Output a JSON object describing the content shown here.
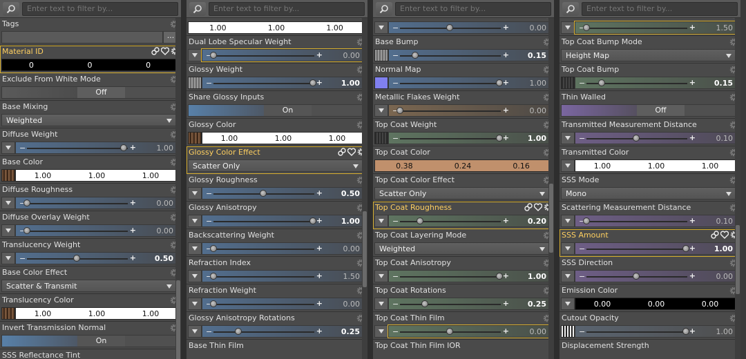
{
  "search_placeholder": "Enter text to filter by...",
  "panels": [
    {
      "props": [
        {
          "label": "Tags",
          "type": "tags",
          "btn": "..."
        },
        {
          "label": "Material ID",
          "type": "color",
          "thumb": null,
          "values": [
            "0",
            "0",
            "0"
          ],
          "bg": "#000",
          "hl": true
        },
        {
          "label": "Exclude From White Mode",
          "type": "toggle",
          "value": "Off"
        },
        {
          "label": "Base Mixing",
          "type": "dropdown",
          "value": "Weighted"
        },
        {
          "label": "Diffuse Weight",
          "type": "slider",
          "knob": 0.97,
          "value": "1.00",
          "bold": false,
          "arrow": true,
          "tint": "blue"
        },
        {
          "label": "Base Color",
          "type": "color",
          "thumb": "hair",
          "values": [
            "1.00",
            "1.00",
            "1.00"
          ],
          "bg": "#fff"
        },
        {
          "label": "Diffuse Roughness",
          "type": "slider",
          "knob": 0.0,
          "value": "0.00",
          "arrow": true,
          "tint": "blue"
        },
        {
          "label": "Diffuse Overlay Weight",
          "type": "slider",
          "knob": 0.0,
          "value": "0.00",
          "arrow": true,
          "tint": "blue"
        },
        {
          "label": "Translucency Weight",
          "type": "slider",
          "knob": 0.5,
          "value": "0.50",
          "bold": true,
          "arrow": true,
          "tint": "blue"
        },
        {
          "label": "Base Color Effect",
          "type": "dropdown",
          "value": "Scatter & Transmit"
        },
        {
          "label": "Translucency Color",
          "type": "color",
          "thumb": "hair",
          "values": [
            "1.00",
            "1.00",
            "1.00"
          ],
          "bg": "#fff"
        },
        {
          "label": "Invert Transmission Normal",
          "type": "toggle",
          "value": "On",
          "on": true
        },
        {
          "label": "SSS Reflectance Tint",
          "type": "partial"
        }
      ]
    },
    {
      "props": [
        {
          "label": "SSS Reflectance Tint",
          "type": "color",
          "thumb": null,
          "values": [
            "1.00",
            "1.00",
            "1.00"
          ],
          "bg": "#fff",
          "top": true
        },
        {
          "label": "Dual Lobe Specular Weight",
          "type": "slider",
          "knob": 0.0,
          "value": "0.00",
          "arrow": true,
          "tint": "blue",
          "hlbox": true
        },
        {
          "label": "Glossy Weight",
          "type": "slider",
          "knob": 1.0,
          "value": "1.00",
          "bold": true,
          "thumb": "grey",
          "tint": "blue"
        },
        {
          "label": "Share Glossy Inputs",
          "type": "toggle",
          "value": "On",
          "on": true
        },
        {
          "label": "Glossy Color",
          "type": "color",
          "thumb": "hair",
          "values": [
            "1.00",
            "1.00",
            "1.00"
          ],
          "bg": "#fff"
        },
        {
          "label": "Glossy Color Effect",
          "type": "dropdown",
          "value": "Scatter Only",
          "hl": true
        },
        {
          "label": "Glossy Roughness",
          "type": "slider",
          "knob": 0.5,
          "value": "0.50",
          "bold": true,
          "arrow": true,
          "tint": "blue"
        },
        {
          "label": "Glossy Anisotropy",
          "type": "slider",
          "knob": 1.0,
          "value": "1.00",
          "bold": true,
          "arrow": true,
          "tint": "blue"
        },
        {
          "label": "Backscattering Weight",
          "type": "slider",
          "knob": 0.0,
          "value": "0.00",
          "arrow": true,
          "tint": "blue"
        },
        {
          "label": "Refraction Index",
          "type": "slider",
          "knob": 0.0,
          "value": "1.50",
          "arrow": true,
          "tint": "blue"
        },
        {
          "label": "Refraction Weight",
          "type": "slider",
          "knob": 0.0,
          "value": "0.00",
          "arrow": true,
          "tint": "blue"
        },
        {
          "label": "Glossy Anisotropy Rotations",
          "type": "slider",
          "knob": 0.25,
          "value": "0.25",
          "bold": true,
          "arrow": true,
          "tint": "blue"
        },
        {
          "label": "Base Thin Film",
          "type": "partial"
        }
      ]
    },
    {
      "props": [
        {
          "label": "Base Thin Film",
          "type": "slider",
          "knob": 0.5,
          "value": "0.00",
          "arrow": true,
          "tint": "blue",
          "top": true
        },
        {
          "label": "Base Bump",
          "type": "slider",
          "knob": 0.15,
          "value": "0.15",
          "bold": true,
          "thumb": "grey",
          "tint": "blue"
        },
        {
          "label": "Normal Map",
          "type": "slider",
          "knob": 1.0,
          "value": "1.00",
          "thumb": "lav",
          "tint": "blue"
        },
        {
          "label": "Metallic Flakes Weight",
          "type": "slider",
          "knob": 0.0,
          "value": "0.00",
          "arrow": true,
          "tint": "orange"
        },
        {
          "label": "Top Coat Weight",
          "type": "slider",
          "knob": 1.0,
          "value": "1.00",
          "bold": true,
          "thumb": "dark",
          "tint": "green"
        },
        {
          "label": "Top Coat Color",
          "type": "color",
          "thumb": null,
          "values": [
            "0.38",
            "0.24",
            "0.16"
          ],
          "bg": "#c0906c"
        },
        {
          "label": "Top Coat Color Effect",
          "type": "dropdown",
          "value": "Scatter Only"
        },
        {
          "label": "Top Coat Roughness",
          "type": "slider",
          "knob": 0.2,
          "value": "0.20",
          "bold": true,
          "arrow": true,
          "tint": "green",
          "hl": true
        },
        {
          "label": "Top Coat Layering Mode",
          "type": "dropdown",
          "value": "Weighted"
        },
        {
          "label": "Top Coat Anisotropy",
          "type": "slider",
          "knob": 1.0,
          "value": "1.00",
          "bold": true,
          "arrow": true,
          "tint": "green"
        },
        {
          "label": "Top Coat Rotations",
          "type": "slider",
          "knob": 0.25,
          "value": "0.25",
          "bold": true,
          "arrow": true,
          "tint": "green"
        },
        {
          "label": "Top Coat Thin Film",
          "type": "slider",
          "knob": 0.5,
          "value": "0.00",
          "arrow": true,
          "tint": "green",
          "hlbox": true
        },
        {
          "label": "Top Coat Thin Film IOR",
          "type": "partial"
        }
      ]
    },
    {
      "props": [
        {
          "label": "Top Coat Thin Film IOR",
          "type": "slider",
          "knob": 0.0,
          "value": "1.50",
          "arrow": true,
          "tint": "green",
          "top": true,
          "hlbox": true
        },
        {
          "label": "Top Coat Bump Mode",
          "type": "dropdown",
          "value": "Height Map"
        },
        {
          "label": "Top Coat Bump",
          "type": "slider",
          "knob": 0.15,
          "value": "0.15",
          "bold": true,
          "thumb": "dark",
          "tint": "green"
        },
        {
          "label": "Thin Walled",
          "type": "toggle",
          "value": "Off",
          "violet": true
        },
        {
          "label": "Transmitted Measurement Distance",
          "type": "slider",
          "knob": 0.5,
          "value": "0.10",
          "arrow": true,
          "tint": "violet"
        },
        {
          "label": "Transmitted Color",
          "type": "color",
          "thumb": null,
          "values": [
            "1.00",
            "1.00",
            "1.00"
          ],
          "bg": "#fff",
          "arrow": true
        },
        {
          "label": "SSS Mode",
          "type": "dropdown",
          "value": "Mono"
        },
        {
          "label": "Scattering Measurement Distance",
          "type": "slider",
          "knob": 0.0,
          "value": "0.10",
          "arrow": true,
          "tint": "violet"
        },
        {
          "label": "SSS Amount",
          "type": "slider",
          "knob": 1.0,
          "value": "1.00",
          "bold": true,
          "arrow": true,
          "tint": "violet",
          "hl": true
        },
        {
          "label": "SSS Direction",
          "type": "slider",
          "knob": 0.5,
          "value": "0.00",
          "arrow": true,
          "tint": "violet"
        },
        {
          "label": "Emission Color",
          "type": "color",
          "thumb": null,
          "values": [
            "0.00",
            "0.00",
            "0.00"
          ],
          "bg": "#000",
          "arrow": true
        },
        {
          "label": "Cutout Opacity",
          "type": "slider",
          "knob": 1.0,
          "value": "1.00",
          "thumb": "stripe",
          "tint": "grey"
        },
        {
          "label": "Displacement Strength",
          "type": "partial"
        }
      ]
    }
  ]
}
